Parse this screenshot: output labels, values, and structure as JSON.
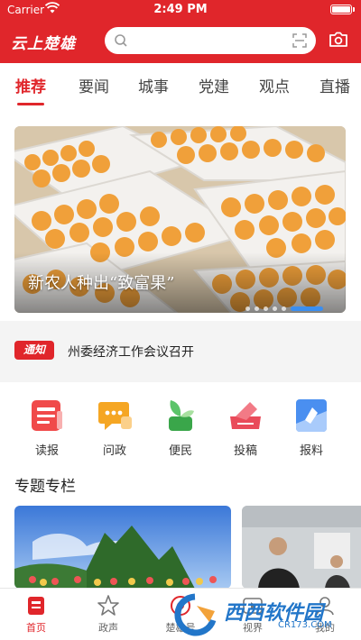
{
  "status_bar": {
    "carrier": "Carrier",
    "time": "2:49 PM"
  },
  "header": {
    "logo": "云上楚雄",
    "search_placeholder": "",
    "icons": [
      "search-icon",
      "scan-icon",
      "camera-icon"
    ]
  },
  "tabs": [
    {
      "label": "推荐",
      "active": true
    },
    {
      "label": "要闻"
    },
    {
      "label": "城事"
    },
    {
      "label": "党建"
    },
    {
      "label": "观点"
    },
    {
      "label": "直播"
    }
  ],
  "banner": {
    "caption": "新农人种出“致富果”",
    "slides": 6,
    "active_slide": 6
  },
  "notice": {
    "badge": "通知",
    "text": "州委经济工作会议召开"
  },
  "quick_actions": [
    {
      "label": "读报",
      "icon": "newspaper-icon"
    },
    {
      "label": "问政",
      "icon": "chat-icon"
    },
    {
      "label": "便民",
      "icon": "plant-icon"
    },
    {
      "label": "投稿",
      "icon": "submit-icon"
    },
    {
      "label": "报料",
      "icon": "report-icon"
    }
  ],
  "special": {
    "title": "专题专栏"
  },
  "bottom_nav": [
    {
      "label": "首页",
      "icon": "home-icon",
      "active": true
    },
    {
      "label": "政声",
      "icon": "star-icon"
    },
    {
      "label": "楚雄号",
      "icon": "media-icon"
    },
    {
      "label": "视界",
      "icon": "video-icon"
    },
    {
      "label": "我的",
      "icon": "user-icon"
    }
  ],
  "watermark": {
    "text": "西西软件园",
    "url": "CR173.COM"
  },
  "colors": {
    "brand": "#e0262b",
    "accent": "#3a8ef0"
  }
}
